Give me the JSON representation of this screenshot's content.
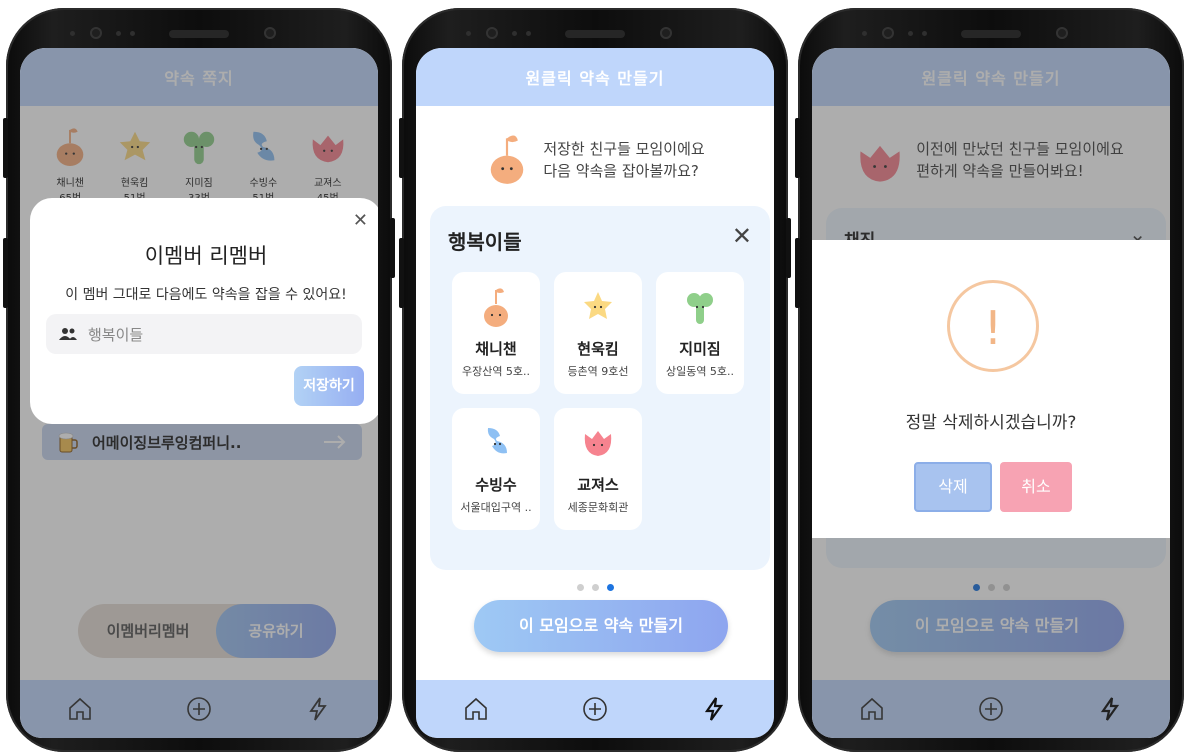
{
  "screen1": {
    "header_title": "약속 쪽지",
    "friends": [
      {
        "name": "채니챈",
        "count": "65번"
      },
      {
        "name": "현욱킴",
        "count": "51번"
      },
      {
        "name": "지미짐",
        "count": "33번"
      },
      {
        "name": "수빙수",
        "count": "51번"
      },
      {
        "name": "교져스",
        "count": "45번"
      }
    ],
    "list_item_label": "어메이징브루잉컴퍼니..",
    "toggle_left": "이멤버리멤버",
    "toggle_right": "공유하기",
    "modal": {
      "title": "이멤버 리멤버",
      "description": "이 멤버 그대로 다음에도 약속을 잡을 수 있어요!",
      "input_value": "행복이들",
      "save_label": "저장하기"
    }
  },
  "screen2": {
    "header_title": "원클릭 약속 만들기",
    "intro_line1": "저장한 친구들 모임이에요",
    "intro_line2": "다음 약속을 잡아볼까요?",
    "group_title": "행복이들",
    "members": [
      {
        "name": "채니챈",
        "station": "우장산역 5호..",
        "color": "#f4ad7e",
        "icon": "sprout-character-icon"
      },
      {
        "name": "현욱킴",
        "station": "등촌역 9호선",
        "color": "#fbd982",
        "icon": "star-character-icon"
      },
      {
        "name": "지미짐",
        "station": "상일동역 5호..",
        "color": "#8fcf8a",
        "icon": "clover-character-icon"
      },
      {
        "name": "수빙수",
        "station": "서울대입구역 ..",
        "color": "#8ec0f3",
        "icon": "lightning-character-icon"
      },
      {
        "name": "교져스",
        "station": "세종문화회관",
        "color": "#f6838f",
        "icon": "tulip-character-icon"
      }
    ],
    "make_button": "이 모임으로 약속 만들기"
  },
  "screen3": {
    "header_title": "원클릭 약속 만들기",
    "intro_line1": "이전에 만났던 친구들 모임이에요",
    "intro_line2": "편하게 약속을 만들어봐요!",
    "panel_title": "채진",
    "dialog_question": "정말 삭제하시겠습니까?",
    "delete_label": "삭제",
    "cancel_label": "취소",
    "make_button": "이 모임으로 약속 만들기"
  }
}
